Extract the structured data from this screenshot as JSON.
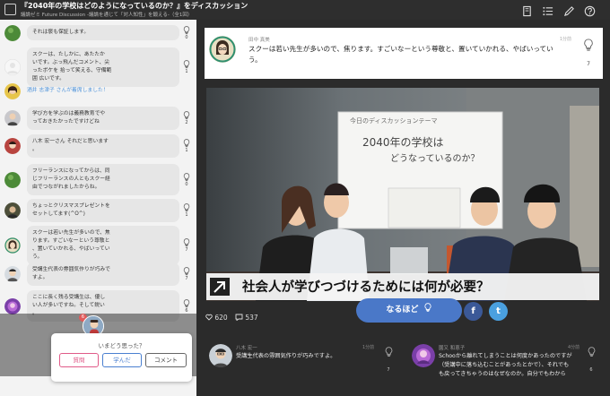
{
  "header": {
    "title": "『2040年の学校はどのようになっているのか？』をディスカッション",
    "subtitle": "議論ゼミ Future Discussion -議論を通じて「対人知性」を鍛える-（全1回）"
  },
  "chat": {
    "messages": [
      {
        "avatar": "avatar-green-ball",
        "text": [
          "それは褒も保証します。"
        ],
        "likes": "0"
      },
      {
        "avatar": "avatar-blank",
        "text": [
          "スクーは、たしかに、あたたか",
          "いです。ぶっ飛んだコメント、尖",
          "ったボケを 拾って笑える、守備範",
          "囲 広いです。"
        ],
        "likes": "1"
      },
      {
        "avatar": "avatar-woman",
        "join": true,
        "text": [
          "酒井 志津子 さんが着席しました！"
        ]
      },
      {
        "avatar": "avatar-person",
        "text": [
          "学び方を学ぶのは義務教育でや",
          "っておきたかったですけどね"
        ],
        "likes": "2"
      },
      {
        "avatar": "avatar-woman-red",
        "text": [
          "八木 宏一さん それだと思います",
          "。"
        ],
        "likes": "1"
      },
      {
        "avatar": "avatar-green-ball",
        "text": [
          "フリーランスになってからは、同",
          "じフリーランスの人ともスクー経",
          "由でつながれましたからね。"
        ],
        "likes": "0"
      },
      {
        "avatar": "avatar-dark",
        "text": [
          "ちょっとクリスマスプレゼントを",
          "セットしてます(^O^)"
        ],
        "likes": "1"
      },
      {
        "avatar": "avatar-illustration",
        "text": [
          "スクーは若い先生が多いので、焦",
          "ります。すごいなーという尊敬と",
          "、置いていかれる、やばいってい",
          "う。"
        ],
        "likes": "7"
      },
      {
        "avatar": "avatar-man-glasses",
        "text": [
          "受講生代表の雰囲気作りが巧みで",
          "すよ。"
        ],
        "likes": "7"
      },
      {
        "avatar": "avatar-purple",
        "text": [
          "ここに長く残る受講生は、優し",
          "い人が多いですね。そして鋭い",
          "。"
        ],
        "likes": "6"
      }
    ]
  },
  "popup": {
    "question": "いまどう思った？",
    "badge": "6",
    "buttons": [
      "質問",
      "学んだ",
      "コメント"
    ]
  },
  "top_comment": {
    "name": "田中 真美",
    "time": "1分前",
    "text": "スクーは若い先生が多いので、焦ります。すごいなーという尊敬と、置いていかれる、やばいっていう。",
    "likes": "7"
  },
  "video": {
    "whiteboard_title": "今日のディスカッションテーマ",
    "whiteboard_main": [
      "2040年の学校は",
      "どうなっているのか？"
    ],
    "caption": "社会人が学びつづけるためには何が必要？"
  },
  "stats": {
    "views": "620",
    "comments": "537"
  },
  "naruhodo_label": "なるほど",
  "social": [
    "f",
    "t"
  ],
  "bottom_comments": [
    {
      "name": "八木 宏一",
      "time": "1分前",
      "text": [
        "受講生代表の雰囲気作りが巧みですよ。"
      ],
      "likes": "7"
    },
    {
      "name": "園又 和恵子",
      "time": "4分前",
      "text": [
        "Schooから離れてしまうことは何度かあったのですが",
        "（受講中に落ち込むことがあったとかで）、それでも",
        "も戻ってきちゃうのはなぜなのか。自分でもわから"
      ],
      "likes": "6"
    }
  ],
  "colors": {
    "header": "#2e2e2e",
    "chat_bg": "#f3f3f3",
    "bubble": "#e6e6e6",
    "main_bg": "#2b2b2b",
    "naruhodo": "#4a78c8",
    "facebook": "#3b5998",
    "twitter": "#4aa0e0",
    "join_text": "#4a90d9",
    "popup_question": "#e05a88",
    "popup_learned": "#4a7fd0"
  },
  "icons": [
    "app-square-icon",
    "book-icon",
    "list-icon",
    "pen-icon",
    "help-icon",
    "bulb-icon",
    "heart-icon",
    "comment-icon",
    "arrow-icon",
    "facebook-icon",
    "twitter-icon"
  ]
}
